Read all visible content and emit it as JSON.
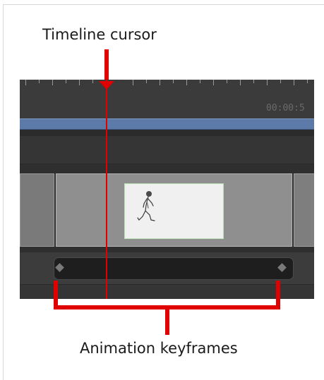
{
  "callouts": {
    "cursor_label": "Timeline cursor",
    "keyframes_label": "Animation keyframes"
  },
  "timeline": {
    "timecode": "00:00:5"
  },
  "colors": {
    "callout_red": "#e00000",
    "work_area_bar": "#5b7aa8",
    "panel_background": "#3a3a3a"
  },
  "icons": {
    "keyframe": "diamond",
    "cursor_head": "triangle-down",
    "clip_thumbnail": "walking-figure"
  }
}
